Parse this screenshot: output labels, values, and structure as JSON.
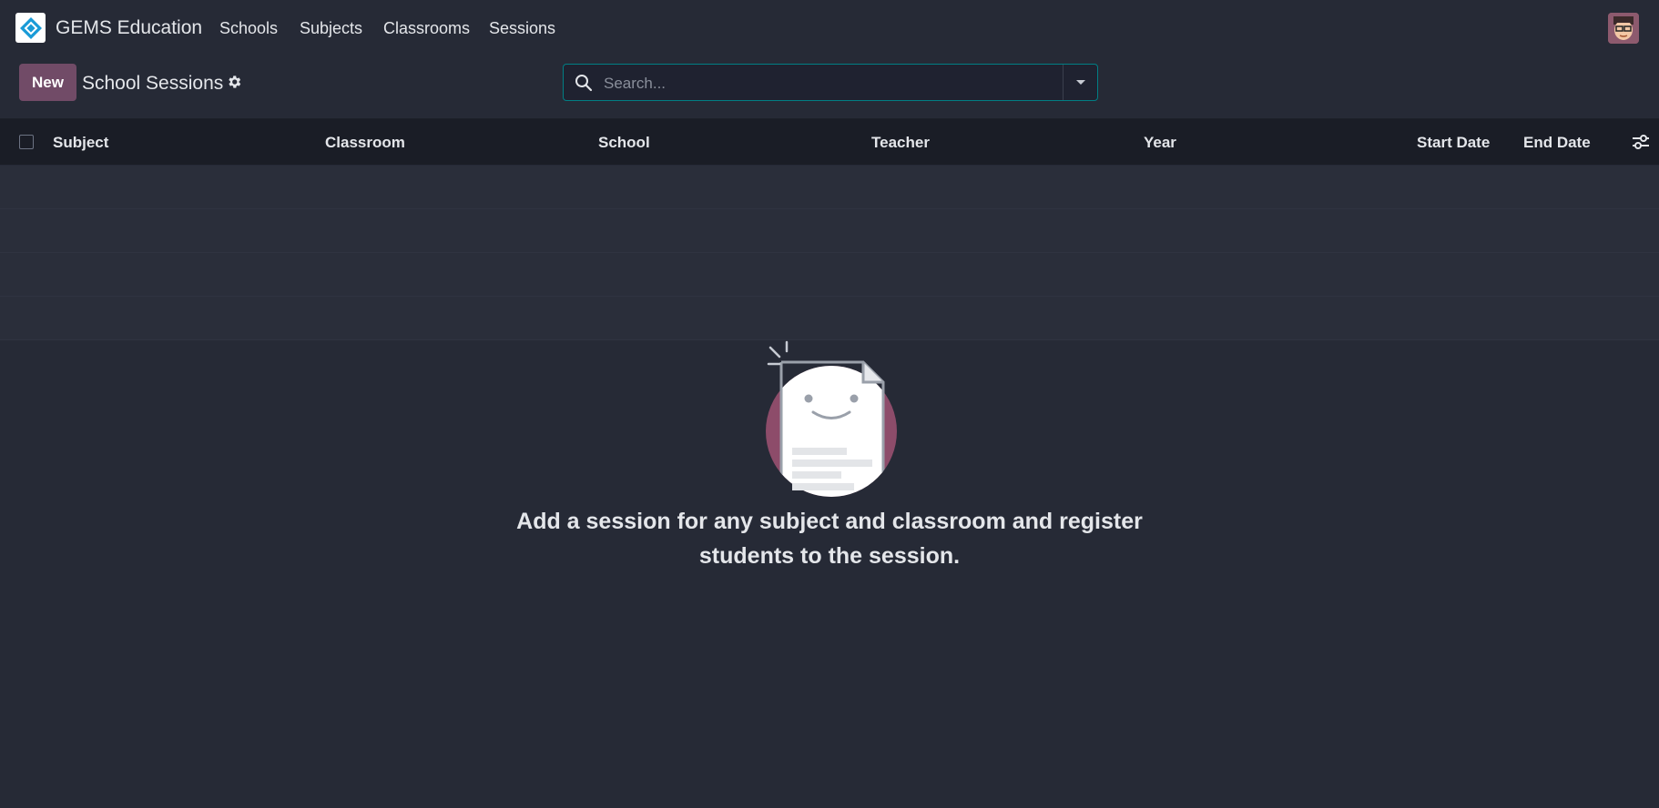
{
  "navbar": {
    "brand": "GEMS Education",
    "menu": [
      "Schools",
      "Subjects",
      "Classrooms",
      "Sessions"
    ]
  },
  "control_panel": {
    "new_label": "New",
    "title": "School Sessions",
    "search_placeholder": "Search..."
  },
  "table": {
    "columns": [
      "Subject",
      "Classroom",
      "School",
      "Teacher",
      "Year",
      "Start Date",
      "End Date"
    ]
  },
  "empty_state": {
    "line1": "Add a session for any subject and classroom and register",
    "line2": "students to the session."
  },
  "colors": {
    "background": "#262A36",
    "primary": "#714B67",
    "search_border": "#017E84",
    "header_bg": "#1A1D26"
  }
}
